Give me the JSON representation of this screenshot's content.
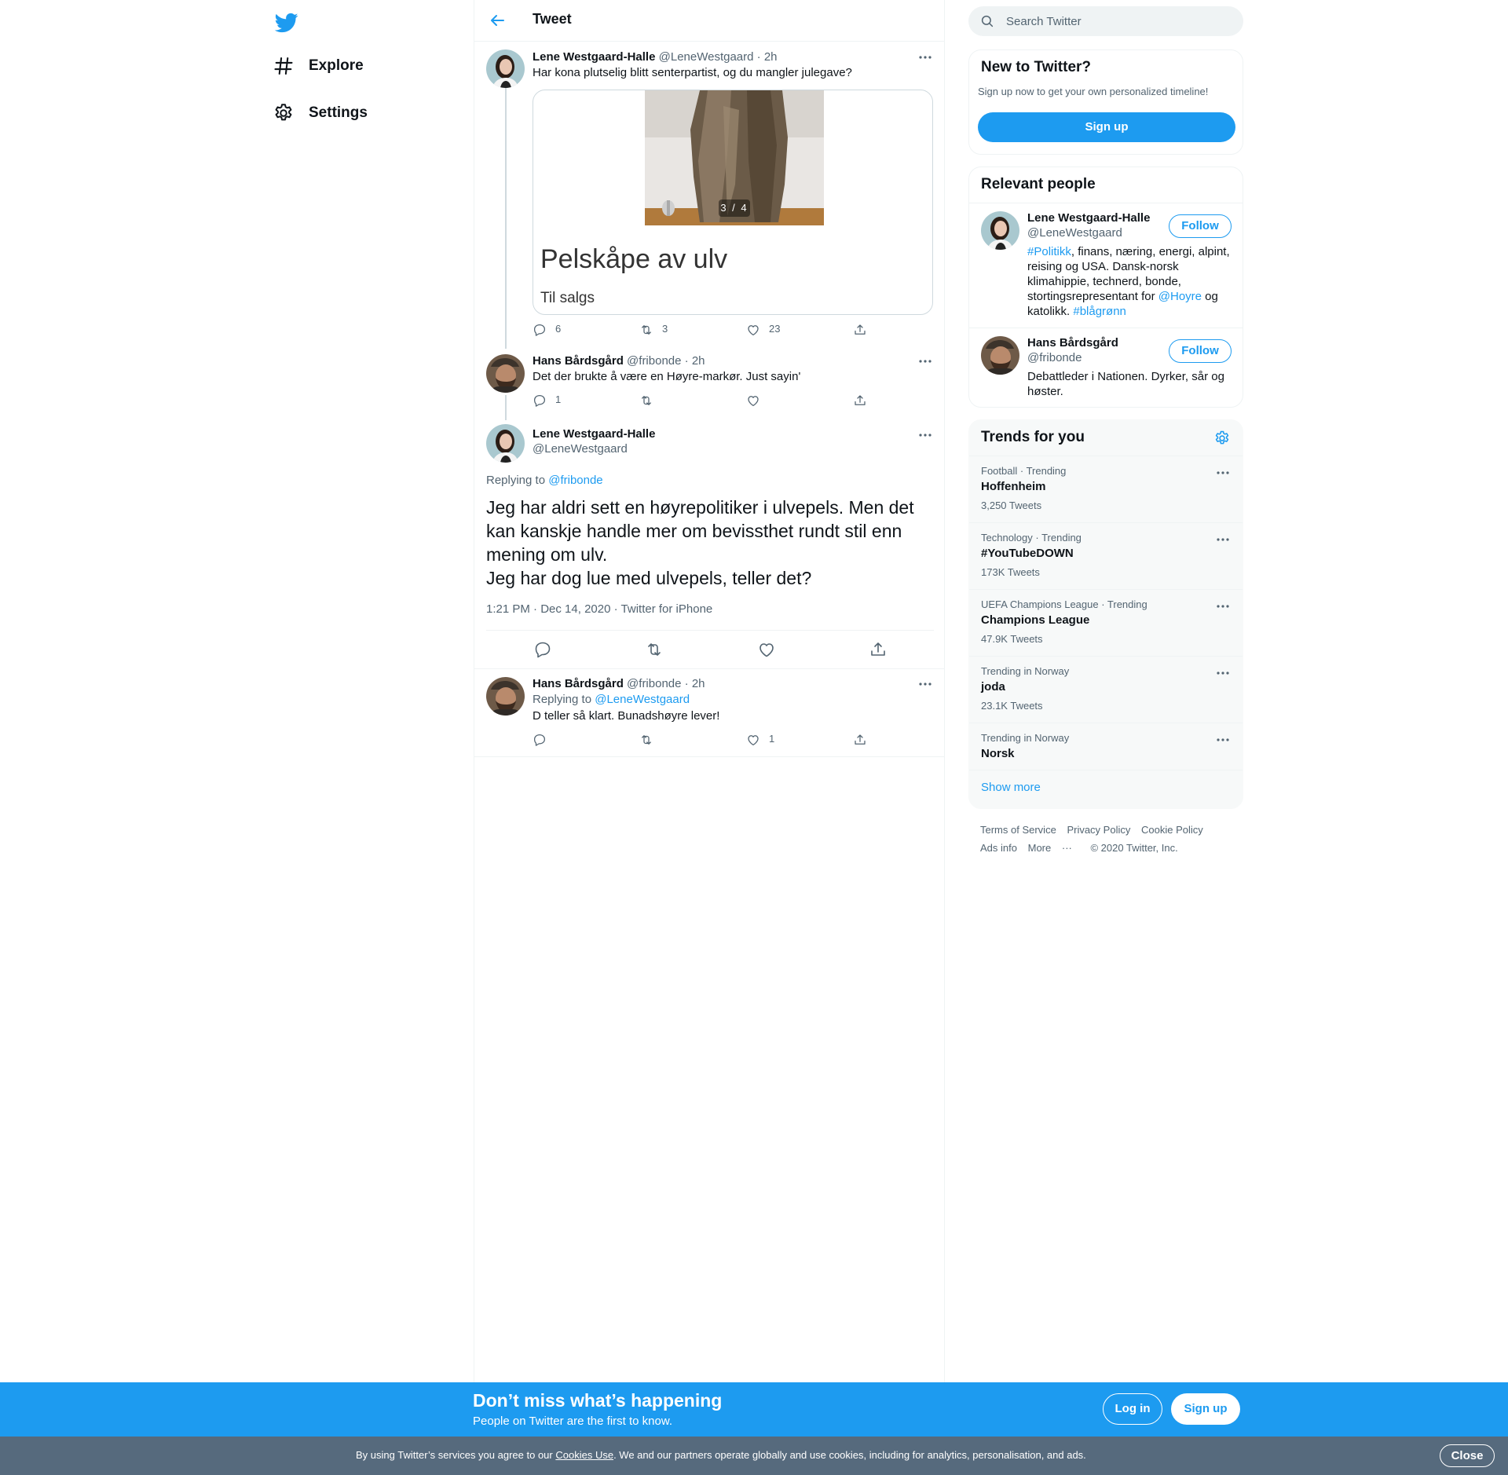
{
  "nav": {
    "explore": "Explore",
    "settings": "Settings"
  },
  "header": {
    "title": "Tweet"
  },
  "tweet1": {
    "name": "Lene Westgaard-Halle",
    "handle": "@LeneWestgaard",
    "time": "2h",
    "text": "Har kona plutselig blitt senterpartist, og du mangler julegave?",
    "card": {
      "counter": "3 / 4",
      "title": "Pelskåpe av ulv",
      "subtitle": "Til salgs"
    },
    "replies": "6",
    "retweets": "3",
    "likes": "23"
  },
  "tweet2": {
    "name": "Hans Bårdsgård",
    "handle": "@fribonde",
    "time": "2h",
    "text": "Det der brukte å være en Høyre-markør. Just sayin'",
    "replies": "1"
  },
  "main_tweet": {
    "name": "Lene Westgaard-Halle",
    "handle": "@LeneWestgaard",
    "replying_prefix": "Replying to",
    "replying_to": "@fribonde",
    "text_lines": [
      "Jeg har aldri sett en høyrepolitiker i ulvepels. Men det",
      "kan kanskje handle mer om bevissthet rundt stil enn",
      "mening om ulv.",
      "Jeg har dog lue med ulvepels, teller det?"
    ],
    "time": "1:21 PM",
    "date": "Dec 14, 2020",
    "source": "Twitter for iPhone"
  },
  "tweet4": {
    "name": "Hans Bårdsgård",
    "handle": "@fribonde",
    "time": "2h",
    "replying_prefix": "Replying to",
    "replying_to": "@LeneWestgaard",
    "text": "D teller så klart. Bunadshøyre lever!",
    "likes": "1"
  },
  "search": {
    "placeholder": "Search Twitter"
  },
  "new_to_twitter": {
    "title": "New to Twitter?",
    "subtitle": "Sign up now to get your own personalized timeline!",
    "button": "Sign up"
  },
  "relevant": {
    "title": "Relevant people",
    "follow_label": "Follow",
    "people": [
      {
        "name": "Lene Westgaard-Halle",
        "handle": "@LeneWestgaard",
        "bio": {
          "tag1": "#Politikk",
          "part1": ", finans, næring, energi, alpint, reising og USA. Dansk-norsk klimahippie, technerd, bonde, stortingsrepresentant for ",
          "mention": "@Hoyre",
          "part2": " og katolikk. ",
          "tag2": "#blågrønn"
        }
      },
      {
        "name": "Hans Bårdsgård",
        "handle": "@fribonde",
        "bio": "Debattleder i Nationen. Dyrker, sår og høster."
      }
    ]
  },
  "trends": {
    "title": "Trends for you",
    "items": [
      {
        "context": "Football · Trending",
        "name": "Hoffenheim",
        "count": "3,250 Tweets"
      },
      {
        "context": "Technology · Trending",
        "name": "#YouTubeDOWN",
        "count": "173K Tweets"
      },
      {
        "context": "UEFA Champions League · Trending",
        "name": "Champions League",
        "count": "47.9K Tweets"
      },
      {
        "context": "Trending in Norway",
        "name": "joda",
        "count": "23.1K Tweets"
      },
      {
        "context": "Trending in Norway",
        "name": "Norsk",
        "count": ""
      }
    ],
    "show_more": "Show more"
  },
  "footer": {
    "terms": "Terms of Service",
    "privacy": "Privacy Policy",
    "cookie": "Cookie Policy",
    "ads": "Ads info",
    "more": "More",
    "copyright": "© 2020 Twitter, Inc."
  },
  "bottom_bar": {
    "title": "Don’t miss what’s happening",
    "subtitle": "People on Twitter are the first to know.",
    "login": "Log in",
    "signup": "Sign up"
  },
  "cookie_bar": {
    "prefix": "By using Twitter’s services you agree to our ",
    "link": "Cookies Use",
    "suffix": ". We and our partners operate globally and use cookies, including for analytics, personalisation, and ads.",
    "close": "Close"
  },
  "colors": {
    "accent": "#1d9bf0",
    "text": "#0f1419",
    "secondary": "#536471",
    "cookie_bg": "#566a7d"
  }
}
